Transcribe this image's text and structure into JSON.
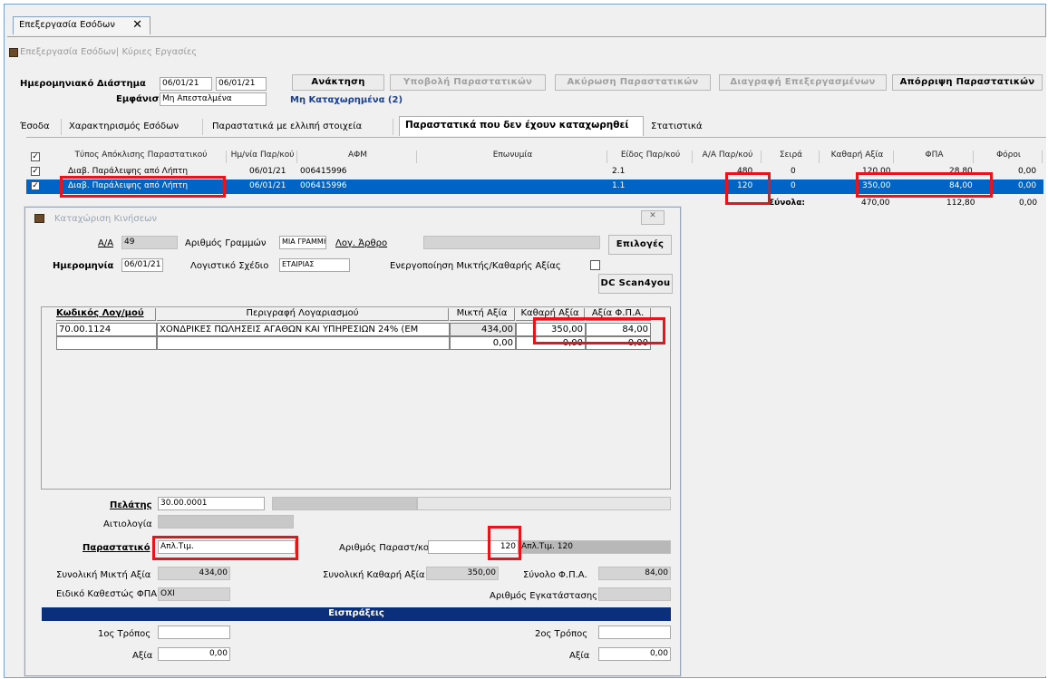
{
  "document_tab": {
    "label": "Επεξεργασία Εσόδων"
  },
  "breadcrumb": "Επεξεργασία Εσόδων| Κύριες Εργασίες",
  "filters": {
    "date_range_label": "Ημερομηνιακό Διάστημα",
    "date_from": "06/01/21",
    "date_to": "06/01/21",
    "display_label": "Εμφάνιση",
    "display_value": "Μη Απεσταλμένα",
    "status_link": "Μη Καταχωρημένα (2)"
  },
  "toolbar": {
    "retrieve": "Ανάκτηση",
    "submit": "Υποβολή Παραστατικών",
    "cancel": "Ακύρωση Παραστατικών",
    "delete": "Διαγραφή Επεξεργασμένων",
    "reject": "Απόρριψη Παραστατικών"
  },
  "tabs": [
    {
      "label": "Έσοδα"
    },
    {
      "label": "Χαρακτηρισμός Εσόδων"
    },
    {
      "label": "Παραστατικά με ελλιπή στοιχεία"
    },
    {
      "label": "Παραστατικά που δεν έχουν καταχωρηθεί"
    },
    {
      "label": "Στατιστικά"
    }
  ],
  "grid": {
    "headers": [
      "Τύπος Απόκλισης Παραστατικού",
      "Ημ/νία Παρ/κού",
      "ΑΦΜ",
      "Επωνυμία",
      "Είδος Παρ/κού",
      "Α/Α Παρ/κού",
      "Σειρά",
      "Καθαρή Αξία",
      "ΦΠΑ",
      "Φόροι"
    ],
    "rows": [
      {
        "type": "Διαβ. Παράλειψης από Λήπτη",
        "date": "06/01/21",
        "afm": "006415996",
        "name": "",
        "kind": "2.1",
        "aa": "480",
        "series": "0",
        "net": "120,00",
        "vat": "28,80",
        "taxes": "0,00"
      },
      {
        "type": "Διαβ. Παράλειψης από Λήπτη",
        "date": "06/01/21",
        "afm": "006415996",
        "name": "",
        "kind": "1.1",
        "aa": "120",
        "series": "0",
        "net": "350,00",
        "vat": "84,00",
        "taxes": "0,00"
      }
    ],
    "totals_label": "Σύνολα:",
    "totals": {
      "net": "470,00",
      "vat": "112,80",
      "taxes": "0,00"
    }
  },
  "dialog": {
    "title": "Καταχώριση Κινήσεων",
    "aa_label": "Α/Α",
    "aa_value": "49",
    "lines_label": "Αριθμός Γραμμών",
    "lines_value": "ΜΙΑ ΓΡΑΜΜΗ",
    "article_label": "Λογ. Άρθρο",
    "options_button": "Επιλογές",
    "date_label": "Ημερομηνία",
    "date_value": "06/01/21",
    "plan_label": "Λογιστικό Σχέδιο",
    "plan_value": "ΕΤΑΙΡΙΑΣ",
    "gross_net_label": "Ενεργοποίηση Μικτής/Καθαρής Αξίας",
    "scan_button": "DC Scan4you",
    "sub_headers": [
      "Κωδικός Λογ/μού",
      "Περιγραφή Λογαριασμού",
      "Μικτή Αξία",
      "Καθαρή Αξία",
      "Αξία Φ.Π.Α."
    ],
    "sub_rows": [
      {
        "code": "70.00.1124",
        "desc": "ΧΟΝΔΡΙΚΕΣ ΠΩΛΗΣΕΙΣ ΑΓΑΘΩΝ ΚΑΙ ΥΠΗΡΕΣΙΩΝ 24% (ΕΜ",
        "gross": "434,00",
        "net": "350,00",
        "vat": "84,00"
      },
      {
        "code": "",
        "desc": "",
        "gross": "0,00",
        "net": "0,00",
        "vat": "0,00"
      }
    ],
    "customer_label": "Πελάτης",
    "customer_value": "30.00.0001",
    "reason_label": "Αιτιολογία",
    "doc_label": "Παραστατικό",
    "doc_value": "Απλ.Τιμ.",
    "doc_no_label": "Αριθμός Παραστ/κού",
    "doc_no_value": "120",
    "doc_desc": "Απλ.Τιμ. 120",
    "total_gross_label": "Συνολική Μικτή Αξία",
    "total_gross": "434,00",
    "total_net_label": "Συνολική Καθαρή Αξία",
    "total_net": "350,00",
    "total_vat_label": "Σύνολο Φ.Π.Α.",
    "total_vat": "84,00",
    "vat_status_label": "Ειδικό Καθεστώς ΦΠΑ",
    "vat_status_value": "ΟΧΙ",
    "install_label": "Αριθμός Εγκατάστασης",
    "receipts_title": "Εισπράξεις",
    "method1_label": "1ος Τρόπος",
    "method2_label": "2ος Τρόπος",
    "value_label": "Αξία",
    "value1": "0,00",
    "value2": "0,00"
  },
  "colors": {
    "selection": "#0063c6",
    "highlight": "#e8131b",
    "section_bar": "#0b2f7a"
  }
}
